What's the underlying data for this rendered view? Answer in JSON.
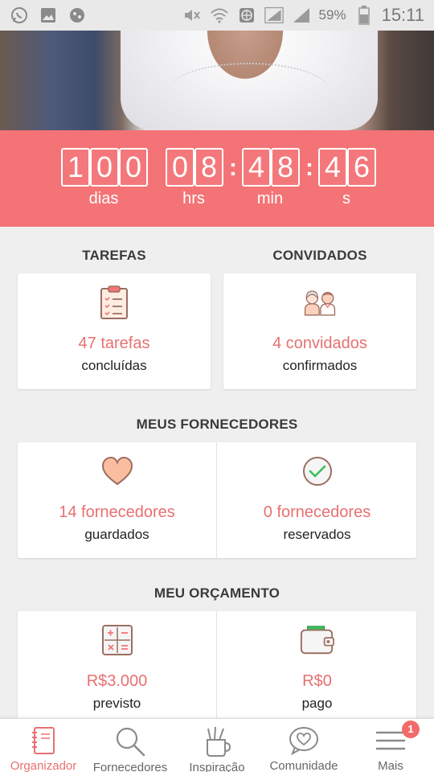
{
  "status_bar": {
    "battery": "59%",
    "time": "15:11"
  },
  "countdown": {
    "days_digits": [
      "1",
      "0",
      "0"
    ],
    "hours_digits": [
      "0",
      "8"
    ],
    "minutes_digits": [
      "4",
      "8"
    ],
    "seconds_digits": [
      "4",
      "6"
    ],
    "separator": ":",
    "days_label": "dias",
    "hours_label": "hrs",
    "minutes_label": "min",
    "seconds_label": "s"
  },
  "tasks": {
    "title": "TAREFAS",
    "value": "47 tarefas",
    "sub": "concluídas",
    "icon": "clipboard-checklist-icon"
  },
  "guests": {
    "title": "CONVIDADOS",
    "value": "4 convidados",
    "sub": "confirmados",
    "icon": "guests-icon"
  },
  "vendors": {
    "title": "MEUS FORNECEDORES",
    "saved_value": "14 fornecedores",
    "saved_sub": "guardados",
    "booked_value": "0 fornecedores",
    "booked_sub": "reservados"
  },
  "budget": {
    "title": "MEU ORÇAMENTO",
    "planned_value": "R$3.000",
    "planned_sub": "previsto",
    "paid_value": "R$0",
    "paid_sub": "pago"
  },
  "nav": {
    "items": [
      {
        "label": "Organizador",
        "icon": "notebook-icon",
        "active": true
      },
      {
        "label": "Fornecedores",
        "icon": "search-icon"
      },
      {
        "label": "Inspiração",
        "icon": "pencil-cup-icon"
      },
      {
        "label": "Comunidade",
        "icon": "chat-heart-icon"
      },
      {
        "label": "Mais",
        "icon": "menu-icon"
      }
    ],
    "badge": "1"
  },
  "colors": {
    "accent": "#f47376",
    "value_text": "#e87071"
  }
}
